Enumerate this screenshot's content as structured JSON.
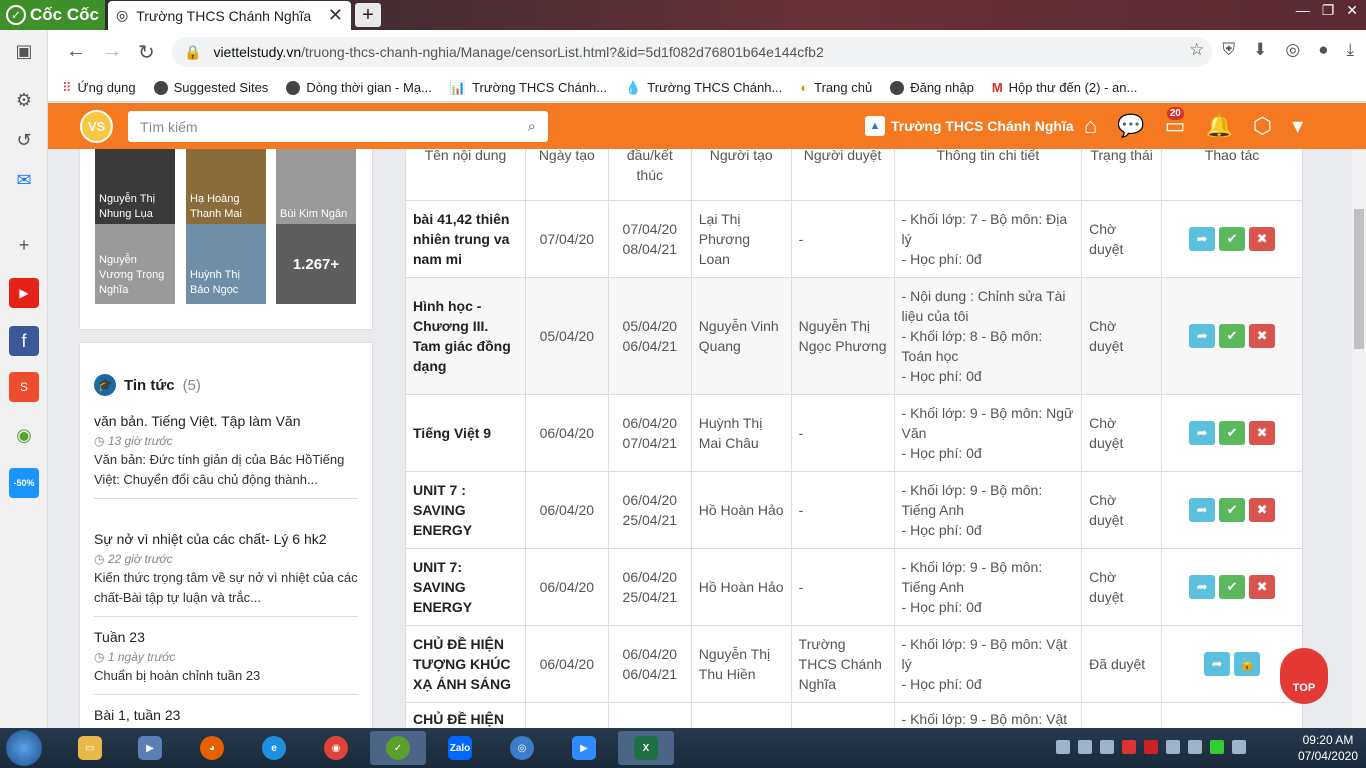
{
  "browser": {
    "brand": "Cốc Cốc",
    "tab_title": "Trường THCS Chánh Nghĩa",
    "url_host": "viettelstudy.vn",
    "url_path": "/truong-thcs-chanh-nghia/Manage/censorList.html?&id=5d1f082d76801b64e144cfb2",
    "bookmarks": [
      "Ứng dụng",
      "Suggested Sites",
      "Dòng thời gian - Mạ...",
      "Trường THCS Chánh...",
      "Trường THCS Chánh...",
      "Trang chủ",
      "Đăng nhập",
      "Hộp thư đến (2) - an..."
    ]
  },
  "app": {
    "search_placeholder": "Tìm kiếm",
    "school_name": "Trường THCS Chánh Nghĩa",
    "notif_count": "20"
  },
  "members": [
    {
      "name": "Nguyễn Thị Nhung Lụa"
    },
    {
      "name": "Hạ Hoàng Thanh Mai"
    },
    {
      "name": "Bùi Kim Ngân"
    },
    {
      "name": "Nguyễn Vương Trọng Nghĩa"
    },
    {
      "name": "Huỳnh Thị Bảo Ngọc"
    }
  ],
  "members_more": "1.267+",
  "news": {
    "title": "Tin tức",
    "count": "(5)",
    "items": [
      {
        "title": "văn bản. Tiếng Việt. Tập làm Văn",
        "time": "13 giờ trước",
        "desc": "Văn bản: Đức tính giản dị của Bác HồTiếng Việt: Chuyển đổi câu chủ động thành..."
      },
      {
        "title": "Sự nở vì nhiệt của các chất- Lý 6 hk2",
        "time": "22 giờ trước",
        "desc": "Kiến thức trọng tâm về sự nở vì nhiệt của các chất-Bài tập tự luận và trắc..."
      },
      {
        "title": "Tuần 23",
        "time": "1 ngày trước",
        "desc": "Chuẩn bị hoàn chỉnh  tuần 23"
      },
      {
        "title": "Bài 1, tuần 23",
        "time": "",
        "desc": ""
      }
    ]
  },
  "table": {
    "headers": [
      "Tên nội dung",
      "Ngày tạo",
      "đầu/kết thúc",
      "Người tạo",
      "Người duyệt",
      "Thông tin chi tiết",
      "Trạng thái",
      "Thao tác"
    ],
    "rows": [
      {
        "name": "bài 41,42 thiên nhiên trung va nam mi",
        "created": "07/04/20",
        "start": "07/04/20",
        "end": "08/04/21",
        "creator": "Lại Thị Phương Loan",
        "approver": "-",
        "info1": "- Khối lớp: 7 - Bộ môn: Địa lý",
        "info2": "- Học phí: 0đ",
        "info3": "",
        "status": "Chờ duyệt"
      },
      {
        "name": "Hình học - Chương III. Tam giác đồng dạng",
        "created": "05/04/20",
        "start": "05/04/20",
        "end": "06/04/21",
        "creator": "Nguyễn Vinh Quang",
        "approver": "Nguyễn Thị Ngọc Phương",
        "info1": "- Nội dung : Chỉnh sửa Tài liệu của tôi",
        "info2": "- Khối lớp: 8 - Bộ môn: Toán học",
        "info3": "- Học phí: 0đ",
        "status": "Chờ duyệt"
      },
      {
        "name": "Tiếng Việt 9",
        "created": "06/04/20",
        "start": "06/04/20",
        "end": "07/04/21",
        "creator": "Huỳnh Thị Mai Châu",
        "approver": "-",
        "info1": "- Khối lớp: 9 - Bộ môn: Ngữ Văn",
        "info2": "- Học phí: 0đ",
        "info3": "",
        "status": "Chờ duyệt"
      },
      {
        "name": "UNIT 7 : SAVING ENERGY",
        "created": "06/04/20",
        "start": "06/04/20",
        "end": "25/04/21",
        "creator": "Hồ Hoàn Hảo",
        "approver": "-",
        "info1": "- Khối lớp: 9 - Bộ môn: Tiếng Anh",
        "info2": "- Học phí: 0đ",
        "info3": "",
        "status": "Chờ duyệt"
      },
      {
        "name": "UNIT 7: SAVING ENERGY",
        "created": "06/04/20",
        "start": "06/04/20",
        "end": "25/04/21",
        "creator": "Hồ Hoàn Hảo",
        "approver": "-",
        "info1": "- Khối lớp: 9 - Bộ môn: Tiếng Anh",
        "info2": "- Học phí: 0đ",
        "info3": "",
        "status": "Chờ duyệt"
      },
      {
        "name": "CHỦ ĐỀ HIỆN TƯỢNG KHÚC XẠ ÁNH SÁNG",
        "created": "06/04/20",
        "start": "06/04/20",
        "end": "06/04/21",
        "creator": "Nguyễn Thị Thu Hiền",
        "approver": "Trường THCS Chánh Nghĩa",
        "info1": "- Khối lớp: 9 - Bộ môn: Vật lý",
        "info2": "- Học phí: 0đ",
        "info3": "",
        "status": "Đã duyệt"
      },
      {
        "name": "CHỦ ĐỀ HIỆN",
        "created": "",
        "start": "",
        "end": "",
        "creator": "",
        "approver": "",
        "info1": "- Khối lớp: 9 - Bộ môn: Vật",
        "info2": "",
        "info3": "",
        "status": ""
      }
    ]
  },
  "top_button": "TOP",
  "taskbar": {
    "time": "09:20 AM",
    "date": "07/04/2020",
    "zalo": "Zalo"
  }
}
